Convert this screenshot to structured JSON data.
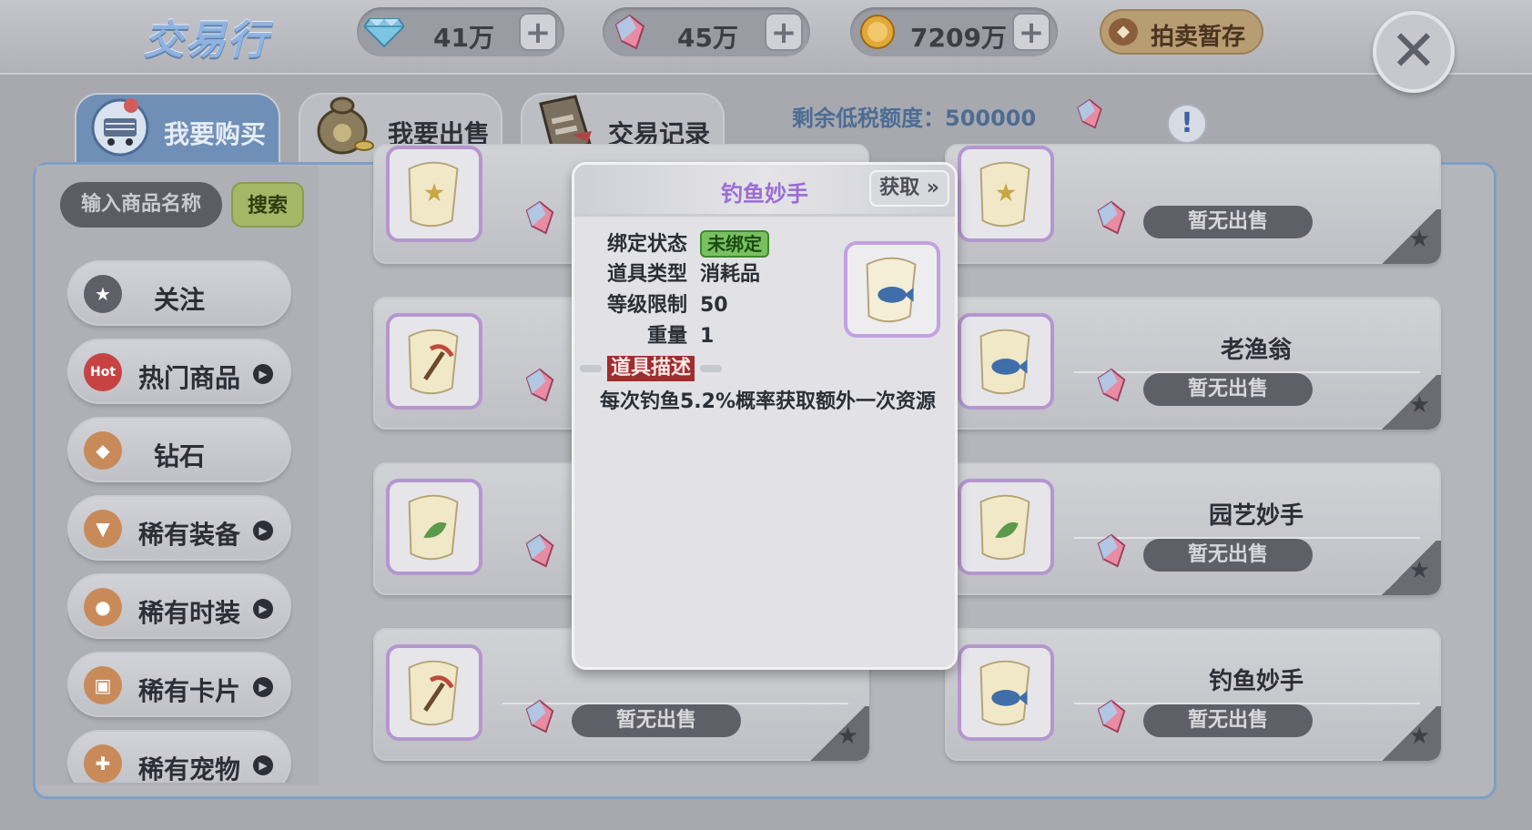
{
  "header": {
    "title": "交易行",
    "currencies": [
      {
        "icon": "diamond-icon",
        "value": "41万"
      },
      {
        "icon": "crystal-icon",
        "value": "45万"
      },
      {
        "icon": "coin-icon",
        "value": "7209万"
      }
    ],
    "auction_label": "拍卖暂存"
  },
  "tabs": [
    {
      "label": "我要购买",
      "icon": "shopping-cart-icon",
      "active": true
    },
    {
      "label": "我要出售",
      "icon": "money-bag-icon",
      "active": false
    },
    {
      "label": "交易记录",
      "icon": "record-book-icon",
      "active": false
    }
  ],
  "tax": {
    "label": "剩余低税额度：",
    "value": "500000"
  },
  "search": {
    "placeholder": "输入商品名称",
    "button": "搜索"
  },
  "categories": [
    {
      "label": "关注",
      "icon": "star-icon",
      "arrow": false
    },
    {
      "label": "热门商品",
      "icon": "hot-icon",
      "arrow": true
    },
    {
      "label": "钻石",
      "icon": "diamond-icon",
      "arrow": false
    },
    {
      "label": "稀有装备",
      "icon": "shirt-icon",
      "arrow": true
    },
    {
      "label": "稀有时装",
      "icon": "hat-icon",
      "arrow": true
    },
    {
      "label": "稀有卡片",
      "icon": "card-icon",
      "arrow": true
    },
    {
      "label": "稀有宠物",
      "icon": "bone-icon",
      "arrow": true
    }
  ],
  "items": [
    {
      "name": "",
      "status": "",
      "scroll_icon": "star-scroll-icon"
    },
    {
      "name": "",
      "status": "暂无出售",
      "scroll_icon": "star-scroll-icon"
    },
    {
      "name": "",
      "status": "",
      "scroll_icon": "pickaxe-scroll-icon"
    },
    {
      "name": "老渔翁",
      "status": "暂无出售",
      "scroll_icon": "fish-scroll-icon"
    },
    {
      "name": "",
      "status": "",
      "scroll_icon": "leaf-scroll-icon"
    },
    {
      "name": "园艺妙手",
      "status": "暂无出售",
      "scroll_icon": "leaf-scroll-icon"
    },
    {
      "name": "",
      "status": "暂无出售",
      "scroll_icon": "pickaxe-scroll-icon"
    },
    {
      "name": "钓鱼妙手",
      "status": "暂无出售",
      "scroll_icon": "fish-scroll-icon"
    }
  ],
  "popup": {
    "title": "钓鱼妙手",
    "obtain_label": "获取 »",
    "rows": [
      {
        "key": "绑定状态",
        "value": "未绑定"
      },
      {
        "key": "道具类型",
        "value": "消耗品"
      },
      {
        "key": "等级限制",
        "value": "50"
      },
      {
        "key": "重量",
        "value": "1"
      }
    ],
    "desc_title": "道具描述",
    "desc": "每次钓鱼5.2%概率获取额外一次资源"
  },
  "colors": {
    "accent": "#6f8fb7",
    "popup_title": "#9a6cd6",
    "search_button": "#a3b766",
    "unbound_badge": "#78c060"
  }
}
